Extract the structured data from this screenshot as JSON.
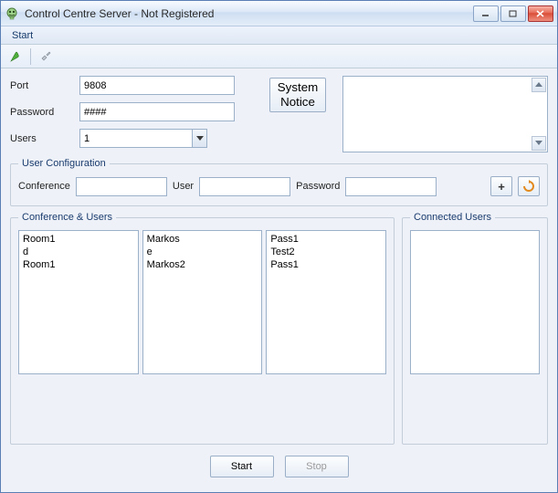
{
  "window": {
    "title": "Control Centre Server - Not Registered"
  },
  "menu": {
    "start": "Start"
  },
  "form": {
    "port_label": "Port",
    "port_value": "9808",
    "password_label": "Password",
    "password_value": "####",
    "users_label": "Users",
    "users_value": "1"
  },
  "buttons": {
    "system_notice": "System\nNotice",
    "add": "+",
    "start": "Start",
    "stop": "Stop"
  },
  "user_config": {
    "legend": "User Configuration",
    "conference_label": "Conference",
    "conference_value": "",
    "user_label": "User",
    "user_value": "",
    "password_label": "Password",
    "password_value": ""
  },
  "conf_users_panel": {
    "legend": "Conference & Users",
    "col_rooms": [
      "Room1",
      "d",
      "Room1"
    ],
    "col_users": [
      "Markos",
      "e",
      "Markos2"
    ],
    "col_pass": [
      "Pass1",
      "Test2",
      "Pass1"
    ]
  },
  "connected_panel": {
    "legend": "Connected Users",
    "items": []
  }
}
